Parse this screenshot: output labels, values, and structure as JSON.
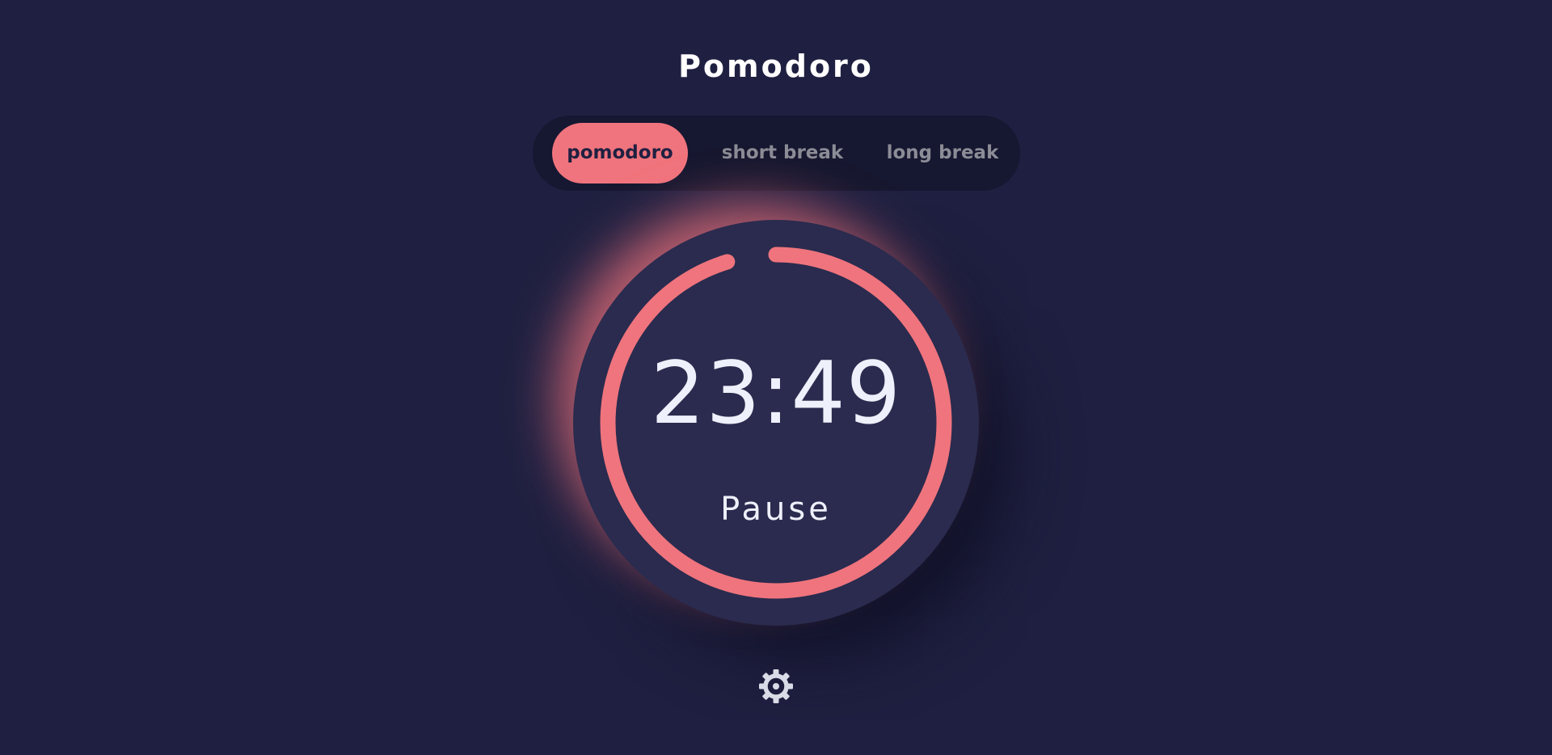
{
  "app": {
    "title": "Pomodoro"
  },
  "modes": [
    {
      "label": "pomodoro",
      "active": true
    },
    {
      "label": "short break",
      "active": false
    },
    {
      "label": "long break",
      "active": false
    }
  ],
  "timer": {
    "time_remaining": "23:49",
    "action_label": "Pause",
    "progress_remaining_fraction": 0.953
  },
  "settings": {
    "icon": "gear-icon"
  },
  "colors": {
    "background": "#1f2041",
    "accent": "#f0747d",
    "tab_bar": "#161730",
    "dial": "#2a2b4e",
    "text": "#eef0fb",
    "inactive_text": "#8b8c96"
  }
}
